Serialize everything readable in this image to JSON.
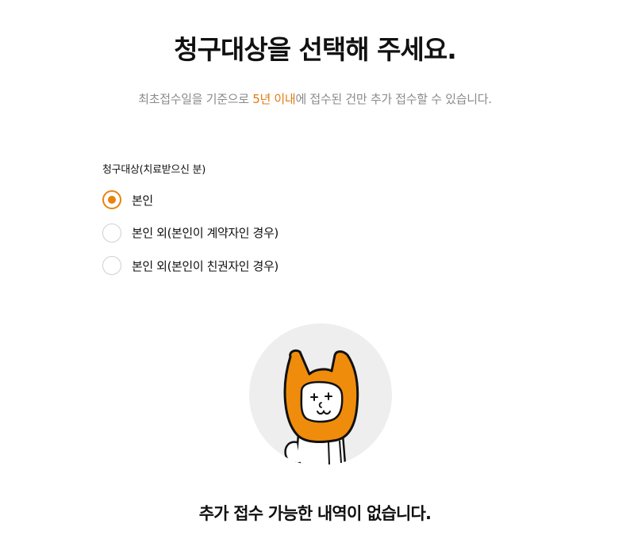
{
  "header": {
    "title": "청구대상을 선택해 주세요.",
    "subtitle_before": "최초접수일을 기준으로 ",
    "subtitle_highlight": "5년 이내",
    "subtitle_after": "에 접수된 건만 추가 접수할 수 있습니다.",
    "highlight_color": "#e07a12"
  },
  "claim_target": {
    "label": "청구대상(치료받으신 분)",
    "options": [
      {
        "label": "본인",
        "selected": true
      },
      {
        "label": "본인 외(본인이 계약자인 경우)",
        "selected": false
      },
      {
        "label": "본인 외(본인이 친권자인 경우)",
        "selected": false
      }
    ],
    "accent_color": "#e8830f"
  },
  "empty_state": {
    "icon": "character-illustration",
    "message": "추가 접수 가능한 내역이 없습니다."
  }
}
